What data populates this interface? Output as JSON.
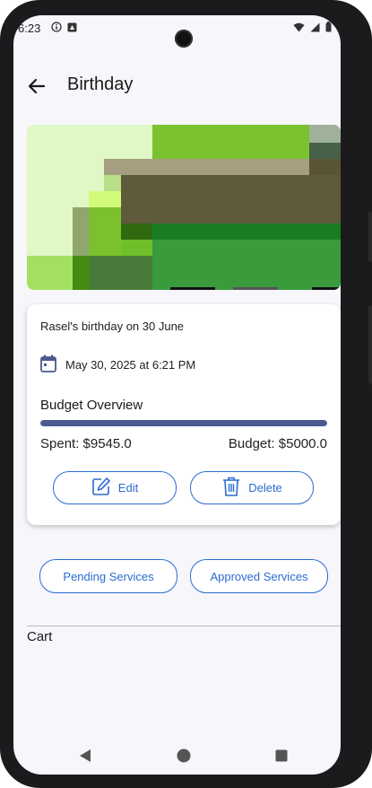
{
  "status_bar": {
    "time": "6:23"
  },
  "app_bar": {
    "title": "Birthday",
    "back_icon": "arrow-back-icon"
  },
  "event": {
    "description": "Rasel's birthday on 30 June",
    "date_time": "May 30, 2025 at 6:21 PM"
  },
  "budget": {
    "heading": "Budget Overview",
    "spent_label": "Spent: $9545.0",
    "budget_label": "Budget: $5000.0",
    "progress_fraction": 1.0
  },
  "actions": {
    "edit_label": "Edit",
    "delete_label": "Delete"
  },
  "services": {
    "pending_label": "Pending Services",
    "approved_label": "Approved Services"
  },
  "cart": {
    "label": "Cart"
  },
  "colors": {
    "accent": "#2a6cd0",
    "progress": "#4a5a8e",
    "background": "#f6f6fb"
  }
}
